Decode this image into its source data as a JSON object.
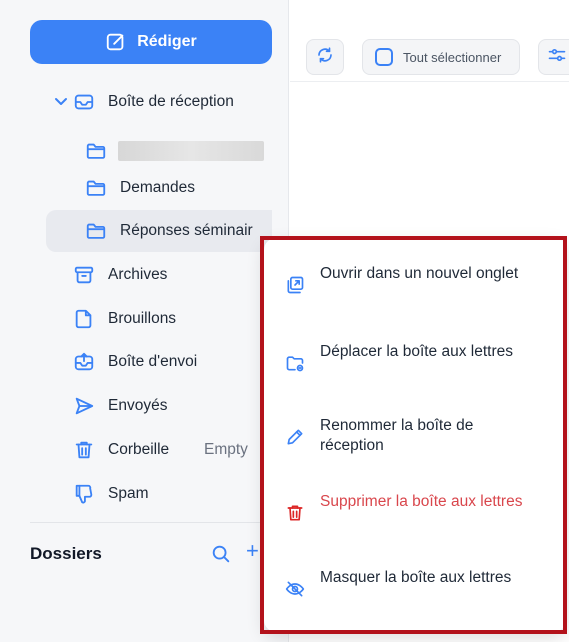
{
  "compose": {
    "label": "Rédiger",
    "icon": "compose-icon"
  },
  "sidebar": {
    "inbox": {
      "label": "Boîte de réception"
    },
    "subfolders": [
      {
        "label": ""
      },
      {
        "label": "Demandes"
      },
      {
        "label": "Réponses séminair"
      }
    ],
    "items": {
      "archives": "Archives",
      "drafts": "Brouillons",
      "outbox": "Boîte d'envoi",
      "sent": "Envoyés",
      "trash": "Corbeille",
      "trash_action": "Empty",
      "spam": "Spam"
    },
    "folders_title": "Dossiers",
    "add_symbol": "+"
  },
  "toolbar": {
    "select_all": "Tout sélectionner"
  },
  "context_menu": {
    "items": [
      {
        "label": "Ouvrir dans un nouvel onglet",
        "icon": "open-new-tab-icon"
      },
      {
        "label": "Déplacer la boîte aux lettres",
        "icon": "move-folder-icon"
      },
      {
        "label": "Renommer la boîte de réception",
        "icon": "pencil-icon"
      },
      {
        "label": "Supprimer la boîte aux lettres",
        "icon": "trash-icon",
        "color": "#d9464c"
      },
      {
        "label": "Masquer la boîte aux lettres",
        "icon": "eye-off-icon"
      }
    ]
  },
  "colors": {
    "accent": "#3b82f6",
    "danger": "#d9464c",
    "highlight": "#b3121b"
  }
}
